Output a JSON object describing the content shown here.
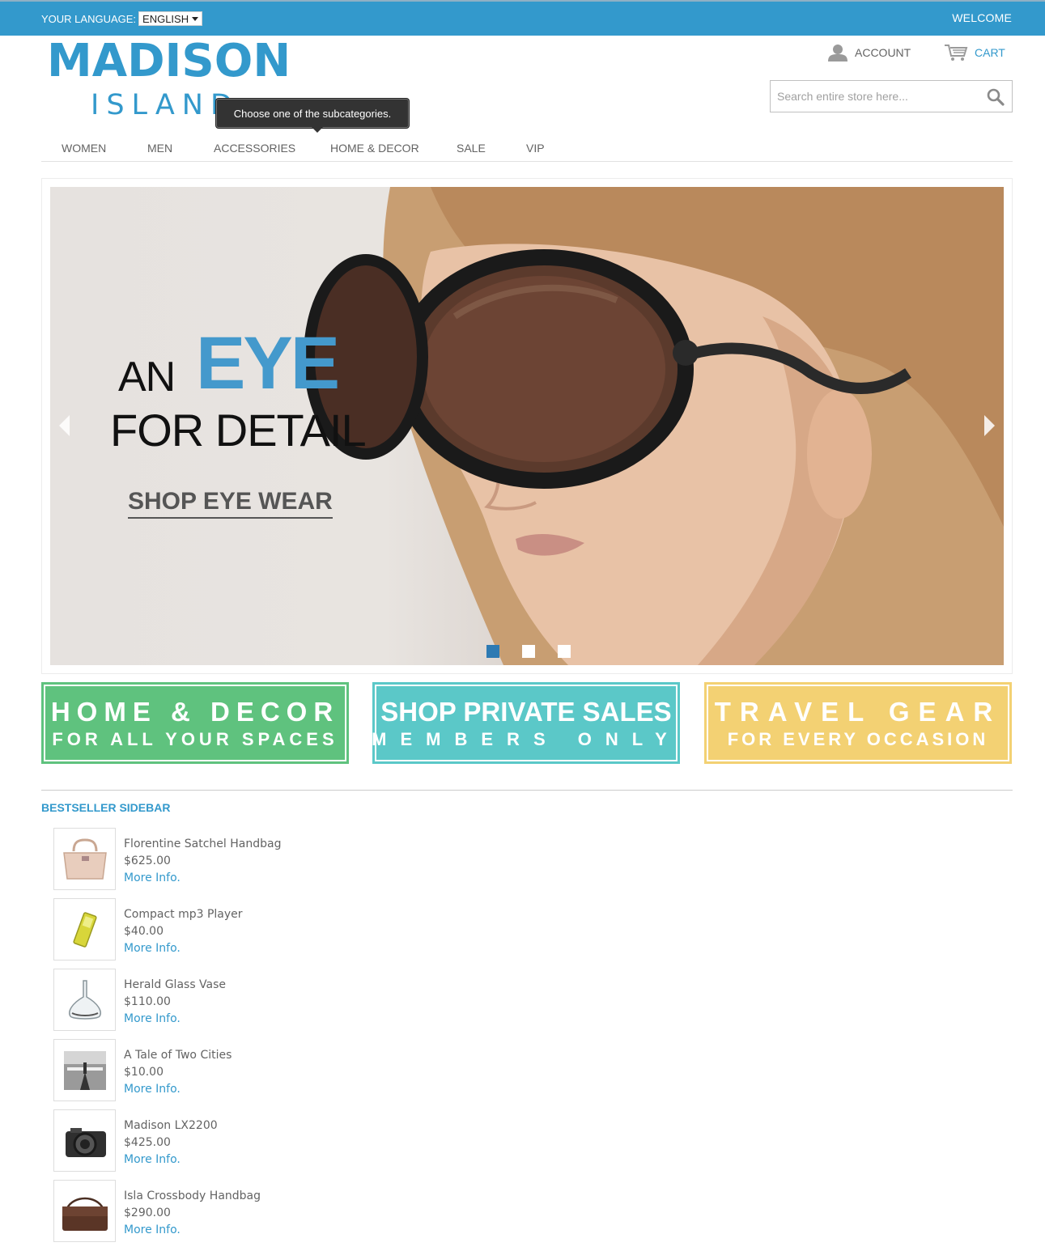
{
  "topbar": {
    "language_label": "YOUR LANGUAGE:",
    "language_value": "ENGLISH",
    "welcome": "WELCOME"
  },
  "logo": {
    "main": "MADISON",
    "sub": "ISLAND"
  },
  "header": {
    "account_label": "ACCOUNT",
    "cart_label": "CART",
    "search_placeholder": "Search entire store here..."
  },
  "tooltip": {
    "text": "Choose one of the subcategories."
  },
  "nav": {
    "items": [
      {
        "label": "WOMEN"
      },
      {
        "label": "MEN"
      },
      {
        "label": "ACCESSORIES"
      },
      {
        "label": "HOME & DECOR"
      },
      {
        "label": "SALE"
      },
      {
        "label": "VIP"
      }
    ]
  },
  "hero": {
    "line1_small": "AN",
    "line1_big": "EYE",
    "line2": "FOR DETAIL",
    "cta": "SHOP EYE WEAR",
    "active_slide": 1,
    "slide_count": 3
  },
  "promos": [
    {
      "line1": "HOME & DECOR",
      "line2": "FOR ALL YOUR SPACES",
      "color": "#5fc27e"
    },
    {
      "line1": "SHOP PRIVATE SALES",
      "line2": "MEMBERS ONLY",
      "color": "#5bc8c8"
    },
    {
      "line1": "TRAVEL GEAR",
      "line2": "FOR EVERY OCCASION",
      "color": "#f3d173"
    }
  ],
  "bestsellers": {
    "title": "BESTSELLER SIDEBAR",
    "items": [
      {
        "name": "Florentine Satchel Handbag",
        "price": "$625.00",
        "link": "More Info.",
        "icon": "handbag-icon"
      },
      {
        "name": "Compact mp3 Player",
        "price": "$40.00",
        "link": "More Info.",
        "icon": "mp3-player-icon"
      },
      {
        "name": "Herald Glass Vase",
        "price": "$110.00",
        "link": "More Info.",
        "icon": "vase-icon"
      },
      {
        "name": "A Tale of Two Cities",
        "price": "$10.00",
        "link": "More Info.",
        "icon": "book-icon"
      },
      {
        "name": "Madison LX2200",
        "price": "$425.00",
        "link": "More Info.",
        "icon": "camera-icon"
      },
      {
        "name": "Isla Crossbody Handbag",
        "price": "$290.00",
        "link": "More Info.",
        "icon": "crossbody-bag-icon"
      }
    ]
  },
  "colors": {
    "brand": "#3399cc",
    "text": "#636363",
    "dot_active": "#2d7ab3"
  }
}
